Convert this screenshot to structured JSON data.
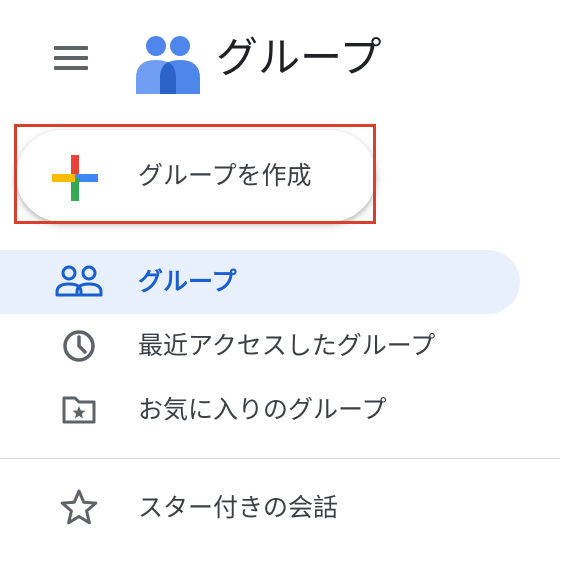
{
  "header": {
    "menu_icon": "hamburger-menu-icon",
    "logo_icon": "groups-logo-icon",
    "title": "グループ"
  },
  "create_button": {
    "icon": "colored-plus-icon",
    "label": "グループを作成"
  },
  "nav": {
    "items": [
      {
        "icon": "people-icon",
        "label": "グループ",
        "active": true
      },
      {
        "icon": "clock-icon",
        "label": "最近アクセスしたグループ",
        "active": false
      },
      {
        "icon": "folder-star-icon",
        "label": "お気に入りのグループ",
        "active": false
      }
    ],
    "secondary": [
      {
        "icon": "star-icon",
        "label": "スター付きの会話",
        "active": false
      }
    ]
  },
  "colors": {
    "accent_blue": "#1a5fd0",
    "active_bg": "#e8f0fe",
    "icon_gray": "#5f6368",
    "highlight_red": "#d93f2b",
    "plus_red": "#ea4335",
    "plus_blue": "#4285f4",
    "plus_green": "#34a853",
    "plus_yellow": "#fbbc04"
  }
}
